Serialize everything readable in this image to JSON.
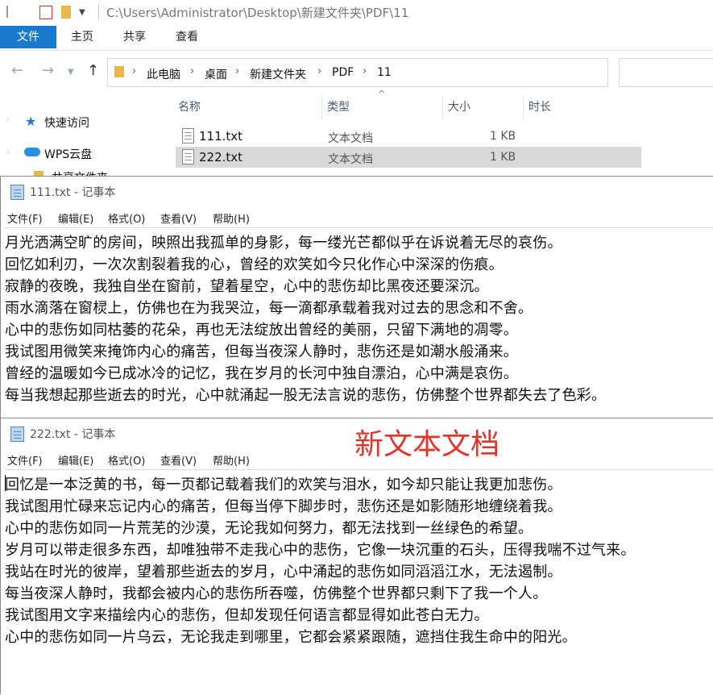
{
  "explorer": {
    "title_path": "C:\\Users\\Administrator\\Desktop\\新建文件夹\\PDF\\11",
    "ribbon_tabs": [
      "文件",
      "主页",
      "共享",
      "查看"
    ],
    "breadcrumbs": [
      "此电脑",
      "桌面",
      "新建文件夹",
      "PDF",
      "11"
    ],
    "nav_items": [
      "快速访问",
      "WPS云盘",
      "共享文件夹"
    ],
    "columns": [
      "名称",
      "类型",
      "大小",
      "时长"
    ],
    "files": [
      {
        "name": "111.txt",
        "type": "文本文档",
        "size": "1 KB"
      },
      {
        "name": "222.txt",
        "type": "文本文档",
        "size": "1 KB"
      }
    ]
  },
  "notepad1": {
    "title": "111.txt - 记事本",
    "menu": [
      "文件(F)",
      "编辑(E)",
      "格式(O)",
      "查看(V)",
      "帮助(H)"
    ],
    "lines": [
      "月光洒满空旷的房间，映照出我孤单的身影，每一缕光芒都似乎在诉说着无尽的哀伤。",
      "回忆如利刃，一次次割裂着我的心，曾经的欢笑如今只化作心中深深的伤痕。",
      "寂静的夜晚，我独自坐在窗前，望着星空，心中的悲伤却比黑夜还要深沉。",
      "雨水滴落在窗棂上，仿佛也在为我哭泣，每一滴都承载着我对过去的思念和不舍。",
      "心中的悲伤如同枯萎的花朵，再也无法绽放出曾经的美丽，只留下满地的凋零。",
      "我试图用微笑来掩饰内心的痛苦，但每当夜深人静时，悲伤还是如潮水般涌来。",
      "曾经的温暖如今已成冰冷的记忆，我在岁月的长河中独自漂泊，心中满是哀伤。",
      "每当我想起那些逝去的时光，心中就涌起一股无法言说的悲伤，仿佛整个世界都失去了色彩。"
    ]
  },
  "notepad2": {
    "title": "222.txt - 记事本",
    "menu": [
      "文件(F)",
      "编辑(E)",
      "格式(O)",
      "查看(V)",
      "帮助(H)"
    ],
    "lines": [
      "回忆是一本泛黄的书，每一页都记载着我们的欢笑与泪水，如今却只能让我更加悲伤。",
      "我试图用忙碌来忘记内心的痛苦，但每当停下脚步时，悲伤还是如影随形地缠绕着我。",
      "心中的悲伤如同一片荒芜的沙漠，无论我如何努力，都无法找到一丝绿色的希望。",
      "岁月可以带走很多东西，却唯独带不走我心中的悲伤，它像一块沉重的石头，压得我喘不过气来。",
      "我站在时光的彼岸，望着那些逝去的岁月，心中涌起的悲伤如同滔滔江水，无法遏制。",
      "每当夜深人静时，我都会被内心的悲伤所吞噬，仿佛整个世界都只剩下了我一个人。",
      "我试图用文字来描绘内心的悲伤，但却发现任何语言都显得如此苍白无力。",
      "心中的悲伤如同一片乌云，无论我走到哪里，它都会紧紧跟随，遮挡住我生命中的阳光。"
    ]
  },
  "overlay": {
    "text": "新文本文档",
    "color": "#e0352b"
  }
}
